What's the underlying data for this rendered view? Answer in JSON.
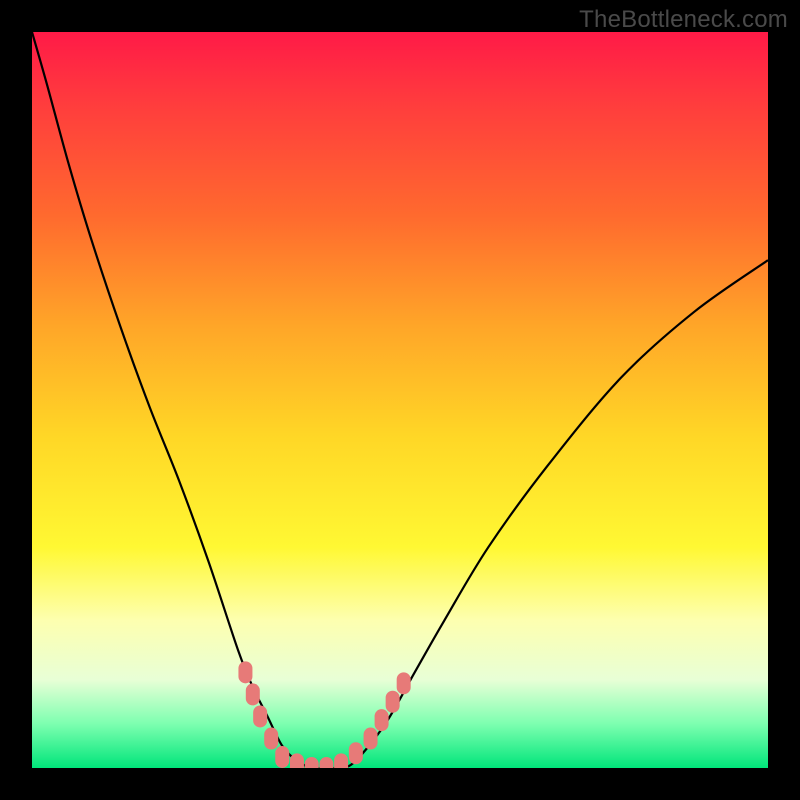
{
  "watermark": "TheBottleneck.com",
  "colors": {
    "frame": "#000000",
    "curve": "#000000",
    "marker": "#e77a78",
    "gradient_top": "#ff1a47",
    "gradient_bottom": "#00e57a"
  },
  "chart_data": {
    "type": "line",
    "title": "",
    "xlabel": "",
    "ylabel": "",
    "xlim": [
      0,
      100
    ],
    "ylim": [
      0,
      100
    ],
    "series": [
      {
        "name": "bottleneck-curve",
        "x": [
          0,
          2,
          5,
          8,
          12,
          16,
          20,
          24,
          28,
          30,
          32,
          34,
          36,
          38,
          40,
          42,
          44,
          48,
          52,
          56,
          62,
          70,
          80,
          90,
          100
        ],
        "y": [
          100,
          93,
          82,
          72,
          60,
          49,
          39,
          28,
          16,
          11,
          7,
          3,
          1,
          0,
          0,
          0,
          1,
          6,
          13,
          20,
          30,
          41,
          53,
          62,
          69
        ]
      }
    ],
    "markers": [
      {
        "x": 29,
        "y": 13
      },
      {
        "x": 30,
        "y": 10
      },
      {
        "x": 31,
        "y": 7
      },
      {
        "x": 32.5,
        "y": 4
      },
      {
        "x": 34,
        "y": 1.5
      },
      {
        "x": 36,
        "y": 0.5
      },
      {
        "x": 38,
        "y": 0
      },
      {
        "x": 40,
        "y": 0
      },
      {
        "x": 42,
        "y": 0.5
      },
      {
        "x": 44,
        "y": 2
      },
      {
        "x": 46,
        "y": 4
      },
      {
        "x": 47.5,
        "y": 6.5
      },
      {
        "x": 49,
        "y": 9
      },
      {
        "x": 50.5,
        "y": 11.5
      }
    ]
  }
}
